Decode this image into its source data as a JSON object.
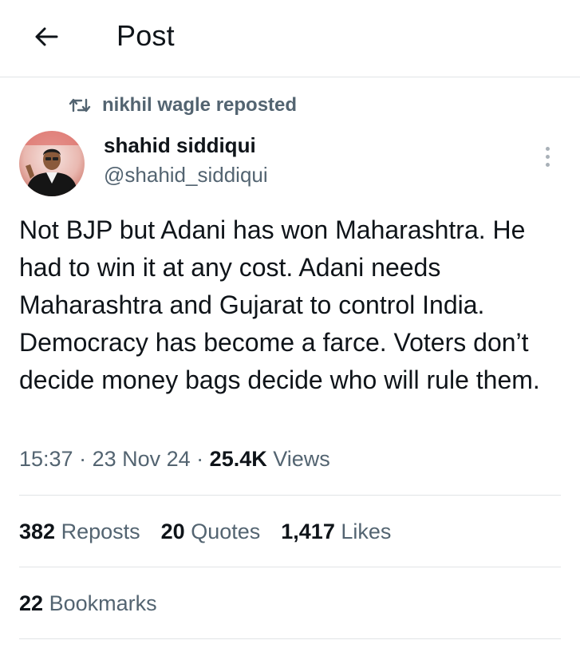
{
  "header": {
    "title": "Post",
    "back_icon": "arrow-left-icon"
  },
  "repost": {
    "icon": "repost-icon",
    "user": "nikhil wagle",
    "suffix": "reposted"
  },
  "author": {
    "name": "shahid siddiqui",
    "handle": "@shahid_siddiqui",
    "avatar": "avatar-photo",
    "more_icon": "more-vertical-icon"
  },
  "post": {
    "text": "Not BJP but Adani has won Maharashtra. He had to win it at any cost. Adani needs Maharashtra and Gujarat to control India. Democracy has become a farce. Voters don’t decide money bags decide who will rule them."
  },
  "meta": {
    "time": "15:37",
    "sep1": " · ",
    "date": "23 Nov 24",
    "sep2": " · ",
    "views_count": "25.4K",
    "views_label": " Views"
  },
  "stats": {
    "reposts_count": "382",
    "reposts_label": "Reposts",
    "quotes_count": "20",
    "quotes_label": "Quotes",
    "likes_count": "1,417",
    "likes_label": "Likes",
    "bookmarks_count": "22",
    "bookmarks_label": "Bookmarks"
  },
  "colors": {
    "text_primary": "#0f1419",
    "text_secondary": "#536471",
    "divider": "#e1e4e6",
    "background": "#ffffff"
  }
}
